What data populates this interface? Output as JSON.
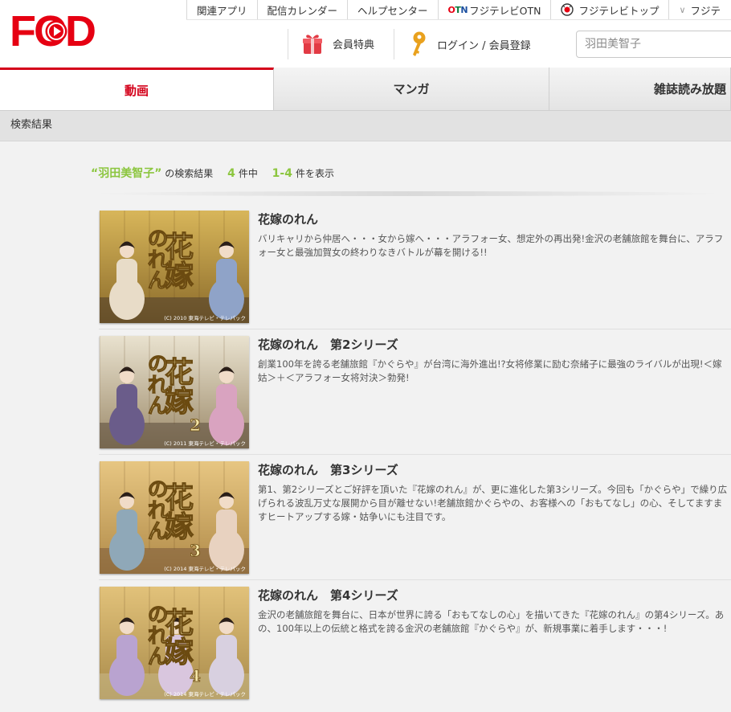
{
  "brand": {
    "logo_text": "FOD",
    "primary_color": "#e60012",
    "accent_green": "#8cc63f"
  },
  "top_nav": [
    {
      "label": "関連アプリ"
    },
    {
      "label": "配信カレンダー"
    },
    {
      "label": "ヘルプセンター"
    },
    {
      "label": "フジテレビOTN",
      "prefix": "OTN"
    },
    {
      "label": "フジテレビトップ"
    },
    {
      "label": "フジテ"
    }
  ],
  "util_nav": {
    "member_benefits": "会員特典",
    "login": "ログイン / 会員登録"
  },
  "search": {
    "value": "羽田美智子"
  },
  "tabs": [
    {
      "label": "動画",
      "active": true
    },
    {
      "label": "マンガ"
    },
    {
      "label": "雑誌読み放題"
    }
  ],
  "breadcrumb": "検索結果",
  "summary": {
    "query": "“羽田美智子”",
    "suffix": "の検索結果",
    "total": "4",
    "total_unit": "件中",
    "range": "1-4",
    "range_unit": "件を表示"
  },
  "results": [
    {
      "title": "花嫁のれん",
      "description": "バリキャリから仲居へ・・・女から嫁へ・・・アラフォー女、想定外の再出発!金沢の老舗旅館を舞台に、アラフォー女と最強加賀女の終わりなきバトルが幕を開ける!!",
      "poster": {
        "title": "花嫁",
        "sub": "のれん",
        "num": "",
        "credit": "(C) 2010 東海テレビ・テレパック"
      }
    },
    {
      "title": "花嫁のれん　第2シリーズ",
      "description": "創業100年を誇る老舗旅館『かぐらや』が台湾に海外進出!?女将修業に励む奈緒子に最強のライバルが出現!＜嫁姑＞＋＜アラフォー女将対決＞勃発!",
      "poster": {
        "title": "花嫁",
        "sub": "のれん",
        "num": "2",
        "credit": "(C) 2011 東海テレビ・テレパック"
      }
    },
    {
      "title": "花嫁のれん　第3シリーズ",
      "description": "第1、第2シリーズとご好評を頂いた『花嫁のれん』が、更に進化した第3シリーズ。今回も「かぐらや」で繰り広げられる波乱万丈な展開から目が離せない!老舗旅館かぐらやの、お客様への「おもてなし」の心、そしてますますヒートアップする嫁・姑争いにも注目です。",
      "poster": {
        "title": "花嫁",
        "sub": "のれん",
        "num": "3",
        "credit": "(C) 2014 東海テレビ・テレパック"
      }
    },
    {
      "title": "花嫁のれん　第4シリーズ",
      "description": "金沢の老舗旅館を舞台に、日本が世界に誇る「おもてなしの心」を描いてきた『花嫁のれん』の第4シリーズ。あの、100年以上の伝統と格式を誇る金沢の老舗旅館『かぐらや』が、新規事業に着手します・・・!",
      "poster": {
        "title": "花嫁",
        "sub": "のれん",
        "num": "4",
        "credit": "(C) 2014 東海テレビ・テレパック"
      }
    }
  ]
}
